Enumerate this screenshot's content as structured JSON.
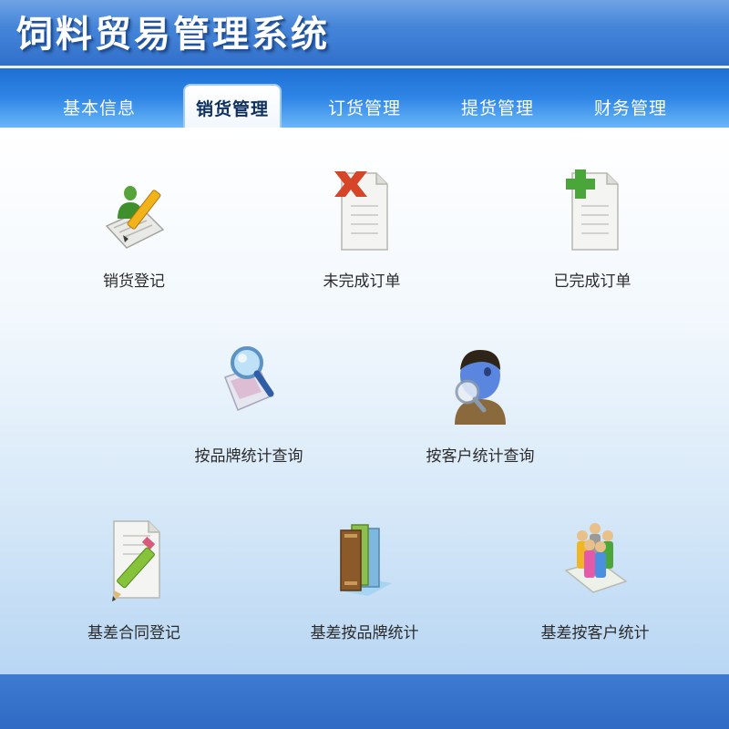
{
  "app": {
    "title": "饲料贸易管理系统"
  },
  "nav": {
    "tabs": [
      {
        "label": "基本信息"
      },
      {
        "label": "销货管理"
      },
      {
        "label": "订货管理"
      },
      {
        "label": "提货管理"
      },
      {
        "label": "财务管理"
      }
    ],
    "active_index": 1
  },
  "main": {
    "items": [
      {
        "label": "销货登记",
        "icon": "pencil-user-notepad-icon"
      },
      {
        "label": "未完成订单",
        "icon": "document-red-x-icon"
      },
      {
        "label": "已完成订单",
        "icon": "document-green-plus-icon"
      },
      {
        "label": "按品牌统计查询",
        "icon": "magnifier-map-icon"
      },
      {
        "label": "按客户统计查询",
        "icon": "person-magnifier-icon"
      },
      {
        "label": "基差合同登记",
        "icon": "document-pencil-icon"
      },
      {
        "label": "基差按品牌统计",
        "icon": "books-icon"
      },
      {
        "label": "基差按客户统计",
        "icon": "people-group-icon"
      }
    ]
  },
  "colors": {
    "header": "#3f7fd6",
    "nav": "#2f86e6",
    "footer": "#3a76cc"
  }
}
